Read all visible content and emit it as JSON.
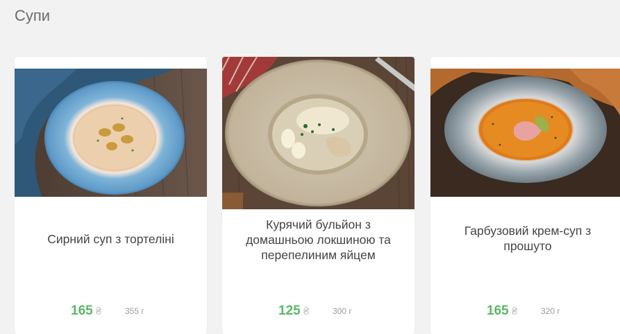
{
  "section": {
    "title": "Супи"
  },
  "products": [
    {
      "name": "Сирний суп з тортеліні",
      "price": "165",
      "currency": "₴",
      "weight": "355 г",
      "image_icon": "cheese-soup-photo"
    },
    {
      "name": "Курячий бульйон з домашньою локшиною та перепелиним яйцем",
      "price": "125",
      "currency": "₴",
      "weight": "300 г",
      "image_icon": "chicken-broth-photo"
    },
    {
      "name": "Гарбузовий крем-суп з прошуто",
      "price": "165",
      "currency": "₴",
      "weight": "320 г",
      "image_icon": "pumpkin-soup-photo"
    }
  ],
  "colors": {
    "price": "#59b866",
    "background": "#f2f2f2",
    "card": "#ffffff"
  }
}
